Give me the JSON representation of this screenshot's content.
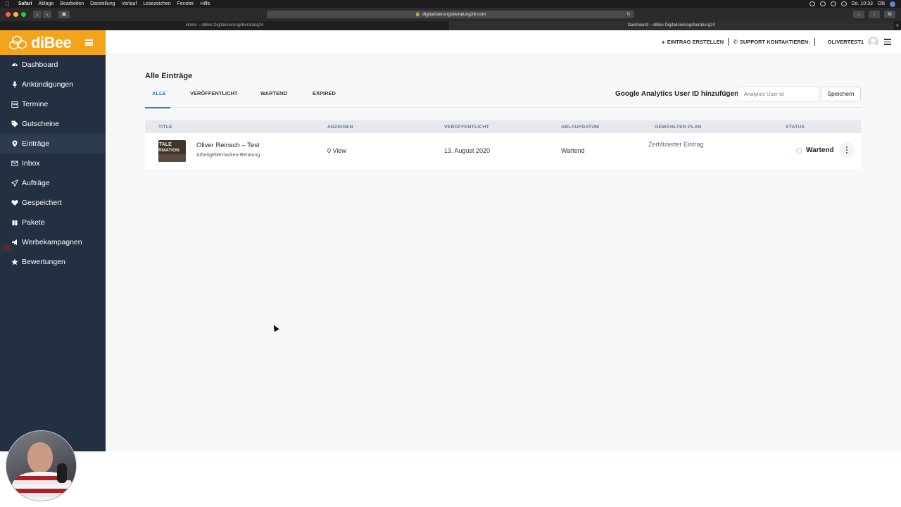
{
  "menubar": {
    "items": [
      "Safari",
      "Ablage",
      "Bearbeiten",
      "Darstellung",
      "Verlauf",
      "Lesezeichen",
      "Fenster",
      "Hilfe"
    ],
    "time": "Do. 10:33",
    "user": "Olli"
  },
  "browser": {
    "url": "digitalisierungsberatung24.com",
    "tabs": [
      "Home – diBee Digitalisierungsberatung24",
      "Dashboard – diBee Digitalisierungsberatung24"
    ]
  },
  "brand": {
    "name": "diBee",
    "color": "#f4a41a"
  },
  "sidebar": {
    "items": [
      {
        "label": "Dashboard",
        "icon": "dashboard-icon"
      },
      {
        "label": "Ankündigungen",
        "icon": "microphone-icon"
      },
      {
        "label": "Termine",
        "icon": "calendar-icon"
      },
      {
        "label": "Gutscheine",
        "icon": "tags-icon"
      },
      {
        "label": "Einträge",
        "icon": "map-marker-icon"
      },
      {
        "label": "Inbox",
        "icon": "envelope-icon"
      },
      {
        "label": "Aufträge",
        "icon": "paper-plane-icon"
      },
      {
        "label": "Gespeichert",
        "icon": "heart-icon"
      },
      {
        "label": "Pakete",
        "icon": "package-icon"
      },
      {
        "label": "Werbekampagnen",
        "icon": "megaphone-icon"
      },
      {
        "label": "Bewertungen",
        "icon": "star-icon"
      }
    ]
  },
  "topbar": {
    "create_label": "EINTRAG ERSTELLEN",
    "support_label": "SUPPORT KONTAKTIEREN:",
    "username": "OLIVERTEST1"
  },
  "page": {
    "title": "Alle Einträge",
    "tabs": [
      "ALLE",
      "VERÖFFENTLICHT",
      "WARTEND",
      "EXPIRED"
    ],
    "ga_label": "Google Analytics User ID hinzufügen",
    "ga_placeholder": "Analytics User Id",
    "save_label": "Speichern"
  },
  "table": {
    "headers": [
      "TITLE",
      "ANZEIGEN",
      "VERÖFFENTLICHT",
      "ABLAUFDATUM",
      "GEWÄHLTER PLAN",
      "STATUS"
    ],
    "rows": [
      {
        "thumb_line1": "TALE",
        "thumb_line2": "RMATION",
        "title": "Oliver Reinsch – Test",
        "subtitle": "Arbeitgebermarken-Beratung",
        "views": "0 View",
        "published": "13. August 2020",
        "expiry": "Wartend",
        "plan": "Zertifizierter Eintrag",
        "status": "Wartend"
      }
    ]
  }
}
